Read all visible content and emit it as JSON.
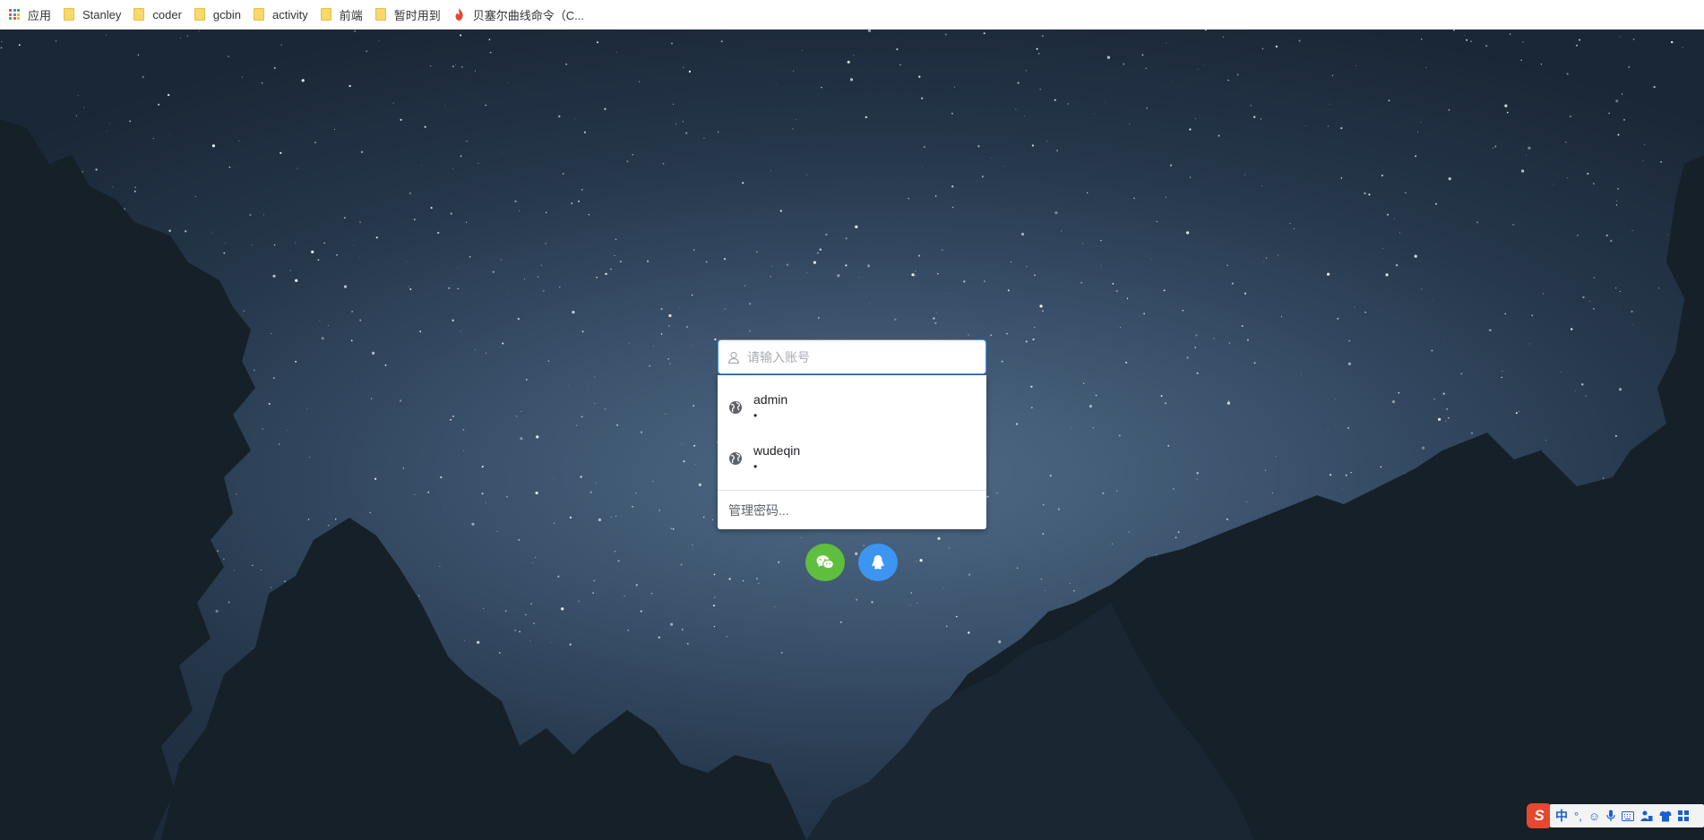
{
  "bookmarks": [
    {
      "label": "应用",
      "icon": "apps-grid-icon"
    },
    {
      "label": "Stanley",
      "icon": "folder-icon"
    },
    {
      "label": "coder",
      "icon": "folder-icon"
    },
    {
      "label": "gcbin",
      "icon": "folder-icon"
    },
    {
      "label": "activity",
      "icon": "folder-icon"
    },
    {
      "label": "前端",
      "icon": "folder-icon"
    },
    {
      "label": "暂时用到",
      "icon": "folder-icon"
    },
    {
      "label": "贝塞尔曲线命令（C...",
      "icon": "flame-icon"
    }
  ],
  "login": {
    "account_placeholder": "请输入账号",
    "account_value": ""
  },
  "autofill": {
    "items": [
      {
        "username": "admin",
        "password": "•"
      },
      {
        "username": "wudeqin",
        "password": "•"
      }
    ],
    "manage_label": "管理密码..."
  },
  "social": {
    "wechat_icon": "wechat-icon",
    "qq_icon": "qq-icon",
    "wechat_color": "#5fbe3d",
    "qq_color": "#3c95f0"
  },
  "ime": {
    "logo": "S",
    "mode": "中"
  },
  "colors": {
    "accent": "#409eff",
    "sky": "#3a516b"
  }
}
